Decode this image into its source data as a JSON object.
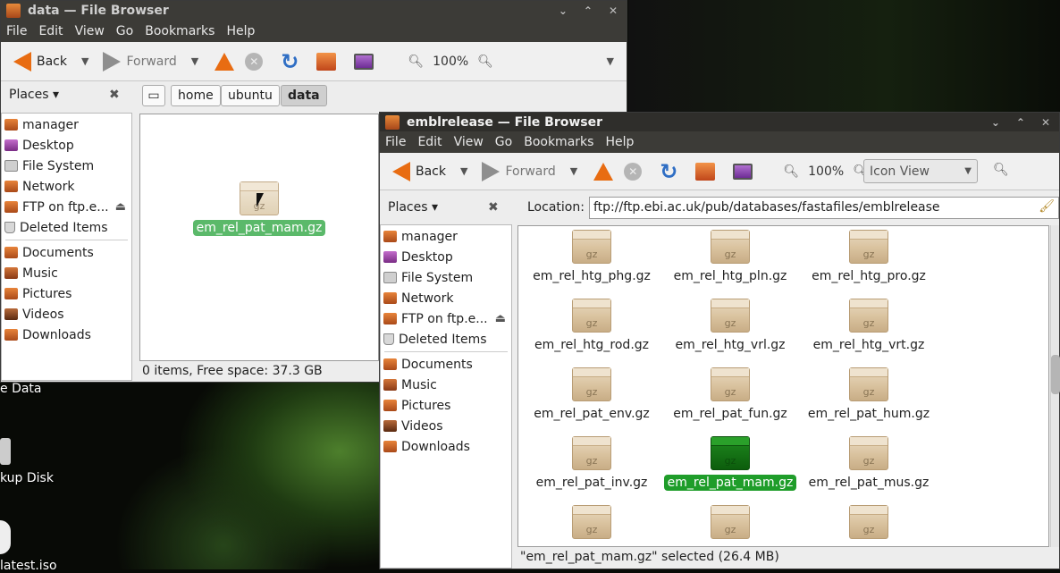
{
  "window1": {
    "title": "data — File Browser",
    "menu": [
      "File",
      "Edit",
      "View",
      "Go",
      "Bookmarks",
      "Help"
    ],
    "toolbar": {
      "back": "Back",
      "forward": "Forward",
      "zoom": "100%"
    },
    "places": {
      "label": "Places ▾",
      "close": "✖",
      "items": [
        "manager",
        "Desktop",
        "File System",
        "Network",
        "FTP on ftp.e...",
        "Deleted Items"
      ],
      "bookmarks": [
        "Documents",
        "Music",
        "Pictures",
        "Videos",
        "Downloads"
      ]
    },
    "breadcrumb": [
      "home",
      "ubuntu",
      "data"
    ],
    "file": "em_rel_pat_mam.gz",
    "status": "0 items, Free space: 37.3 GB"
  },
  "window2": {
    "title": "emblrelease — File Browser",
    "menu": [
      "File",
      "Edit",
      "View",
      "Go",
      "Bookmarks",
      "Help"
    ],
    "toolbar": {
      "back": "Back",
      "forward": "Forward",
      "zoom": "100%",
      "view": "Icon View"
    },
    "places": {
      "label": "Places ▾",
      "close": "✖",
      "items": [
        "manager",
        "Desktop",
        "File System",
        "Network",
        "FTP on ftp.e...",
        "Deleted Items"
      ],
      "bookmarks": [
        "Documents",
        "Music",
        "Pictures",
        "Videos",
        "Downloads"
      ]
    },
    "location_label": "Location:",
    "location": "ftp://ftp.ebi.ac.uk/pub/databases/fastafiles/emblrelease",
    "files": [
      "em_rel_htg_phg.gz",
      "em_rel_htg_pln.gz",
      "em_rel_htg_pro.gz",
      "em_rel_htg_rod.gz",
      "em_rel_htg_vrl.gz",
      "em_rel_htg_vrt.gz",
      "em_rel_pat_env.gz",
      "em_rel_pat_fun.gz",
      "em_rel_pat_hum.gz",
      "em_rel_pat_inv.gz",
      "em_rel_pat_mam.gz",
      "em_rel_pat_mus.gz"
    ],
    "selected": "em_rel_pat_mam.gz",
    "status": "\"em_rel_pat_mam.gz\" selected (26.4 MB)"
  },
  "desktop": {
    "labels": [
      "e Data",
      "kup Disk",
      "latest.iso"
    ]
  }
}
